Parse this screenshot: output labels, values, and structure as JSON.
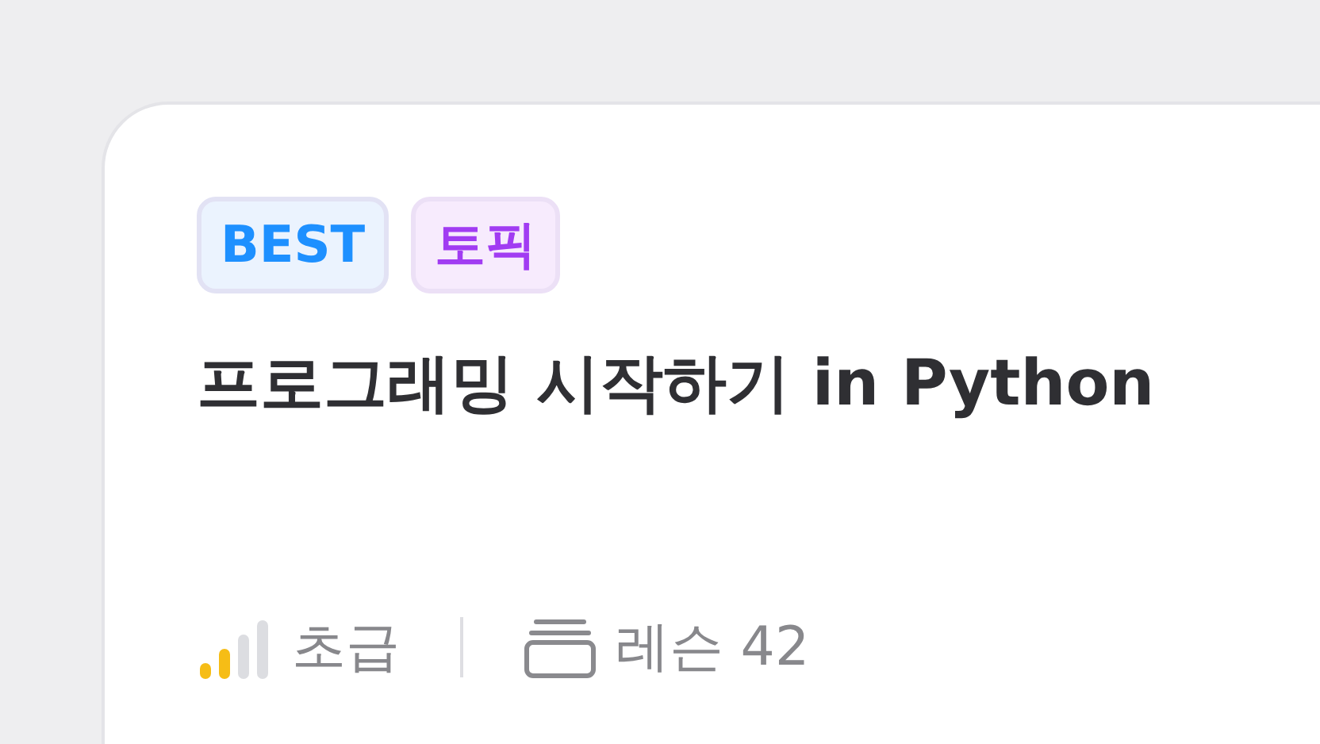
{
  "badges": [
    {
      "label": "BEST",
      "kind": "best"
    },
    {
      "label": "토픽",
      "kind": "topic"
    }
  ],
  "title": "프로그래밍 시작하기 in Python",
  "difficulty": {
    "level": 0.5,
    "label": "초급"
  },
  "lessons": {
    "label": "레슨 42"
  }
}
